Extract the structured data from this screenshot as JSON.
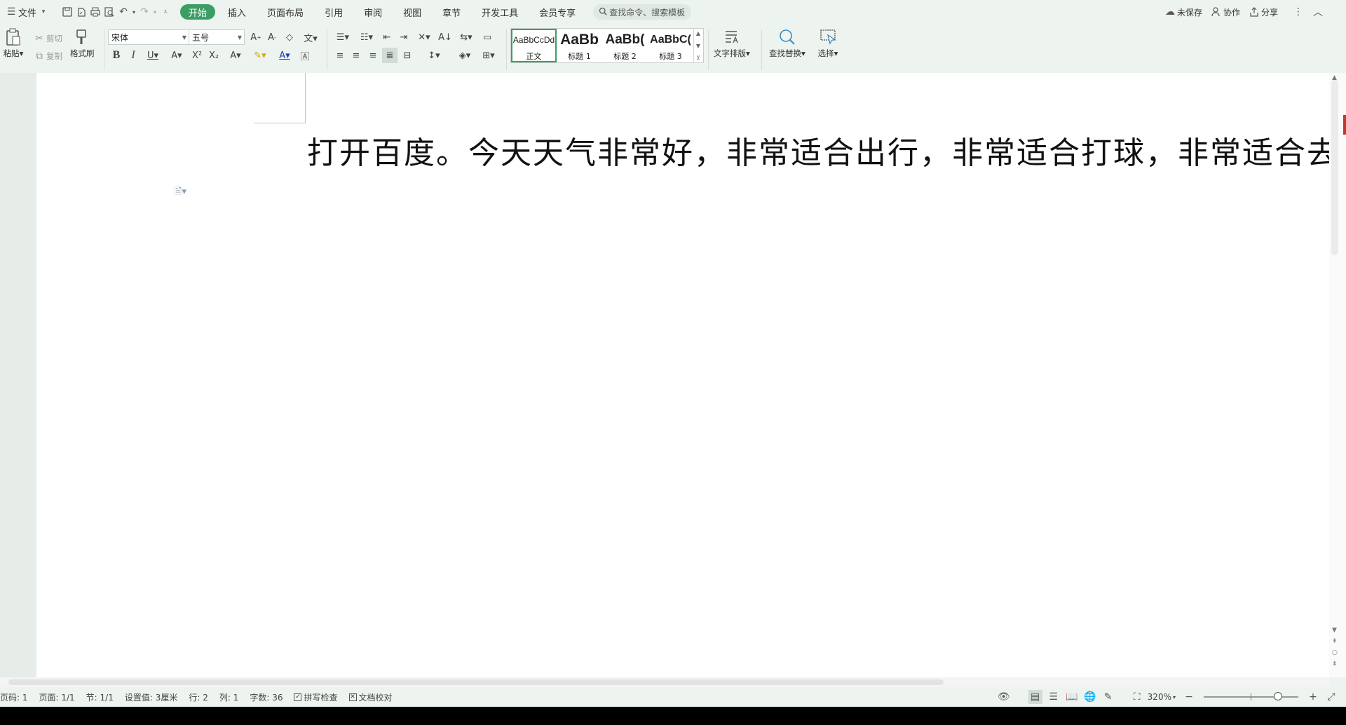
{
  "menubar": {
    "file_label": "文件",
    "tabs": [
      {
        "label": "开始",
        "active": true
      },
      {
        "label": "插入"
      },
      {
        "label": "页面布局"
      },
      {
        "label": "引用"
      },
      {
        "label": "审阅"
      },
      {
        "label": "视图"
      },
      {
        "label": "章节"
      },
      {
        "label": "开发工具"
      },
      {
        "label": "会员专享"
      }
    ],
    "search_placeholder": "查找命令、搜索模板",
    "unsaved_label": "未保存",
    "collab_label": "协作",
    "share_label": "分享"
  },
  "ribbon": {
    "paste_label": "粘贴",
    "cut_label": "剪切",
    "copy_label": "复制",
    "format_painter_label": "格式刷",
    "font_name": "宋体",
    "font_size": "五号",
    "styles": [
      {
        "preview": "AaBbCcDd",
        "name": "正文"
      },
      {
        "preview": "AaBb",
        "name": "标题 1"
      },
      {
        "preview": "AaBb(",
        "name": "标题 2"
      },
      {
        "preview": "AaBbC(",
        "name": "标题 3"
      }
    ],
    "text_layout_label": "文字排版",
    "find_replace_label": "查找替换",
    "select_label": "选择"
  },
  "document": {
    "text": "打开百度。今天天气非常好，非常适合出行，非常适合打球，非常适合去喝"
  },
  "statusbar": {
    "page_num": "页码: 1",
    "pages": "页面: 1/1",
    "section": "节: 1/1",
    "setting": "设置值: 3厘米",
    "row": "行: 2",
    "col": "列: 1",
    "word_count": "字数: 36",
    "spell_check": "拼写检查",
    "doc_proof": "文档校对",
    "zoom": "320%"
  },
  "colors": {
    "accent": "#3c9e64",
    "chrome_bg": "#edf3ef"
  }
}
